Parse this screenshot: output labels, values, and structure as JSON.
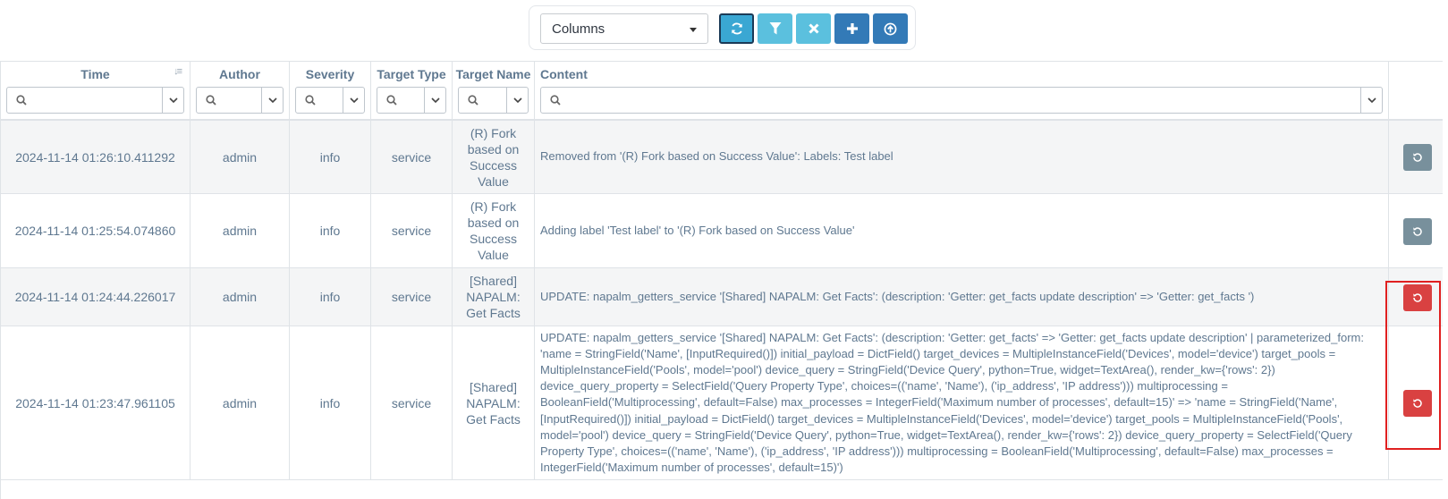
{
  "toolbar": {
    "columns_label": "Columns",
    "buttons": [
      {
        "name": "refresh",
        "icon": "refresh-icon"
      },
      {
        "name": "filter",
        "icon": "filter-icon"
      },
      {
        "name": "clear",
        "icon": "close-icon"
      },
      {
        "name": "add",
        "icon": "plus-icon"
      },
      {
        "name": "upload",
        "icon": "upload-icon"
      }
    ]
  },
  "table": {
    "columns": [
      "Time",
      "Author",
      "Severity",
      "Target Type",
      "Target Name",
      "Content"
    ],
    "rows": [
      {
        "time": "2024-11-14 01:26:10.411292",
        "author": "admin",
        "severity": "info",
        "target_type": "service",
        "target_name": "(R) Fork based on Success Value",
        "content": "Removed from '(R) Fork based on Success Value': Labels: Test label",
        "action": "gray"
      },
      {
        "time": "2024-11-14 01:25:54.074860",
        "author": "admin",
        "severity": "info",
        "target_type": "service",
        "target_name": "(R) Fork based on Success Value",
        "content": "Adding label 'Test label' to '(R) Fork based on Success Value'",
        "action": "gray"
      },
      {
        "time": "2024-11-14 01:24:44.226017",
        "author": "admin",
        "severity": "info",
        "target_type": "service",
        "target_name": "[Shared] NAPALM: Get Facts",
        "content": "UPDATE: napalm_getters_service '[Shared] NAPALM: Get Facts': (description: 'Getter: get_facts update description' => 'Getter: get_facts ')",
        "action": "red"
      },
      {
        "time": "2024-11-14 01:23:47.961105",
        "author": "admin",
        "severity": "info",
        "target_type": "service",
        "target_name": "[Shared] NAPALM: Get Facts",
        "content": "UPDATE: napalm_getters_service '[Shared] NAPALM: Get Facts': (description: 'Getter: get_facts' => 'Getter: get_facts update description' | parameterized_form: 'name = StringField('Name', [InputRequired()]) initial_payload = DictField() target_devices = MultipleInstanceField('Devices', model='device') target_pools = MultipleInstanceField('Pools', model='pool') device_query = StringField('Device Query', python=True, widget=TextArea(), render_kw={'rows': 2}) device_query_property = SelectField('Query Property Type', choices=(('name', 'Name'), ('ip_address', 'IP address'))) multiprocessing = BooleanField('Multiprocessing', default=False) max_processes = IntegerField('Maximum number of processes', default=15)' => 'name = StringField('Name', [InputRequired()]) initial_payload = DictField() target_devices = MultipleInstanceField('Devices', model='device') target_pools = MultipleInstanceField('Pools', model='pool') device_query = StringField('Device Query', python=True, widget=TextArea(), render_kw={'rows': 2}) device_query_property = SelectField('Query Property Type', choices=(('name', 'Name'), ('ip_address', 'IP address'))) multiprocessing = BooleanField('Multiprocessing', default=False) max_processes = IntegerField('Maximum number of processes', default=15)')",
        "action": "red"
      }
    ]
  },
  "colors": {
    "gray_button": "#78909c",
    "red_button": "#d94141",
    "highlight": "#e02020"
  }
}
